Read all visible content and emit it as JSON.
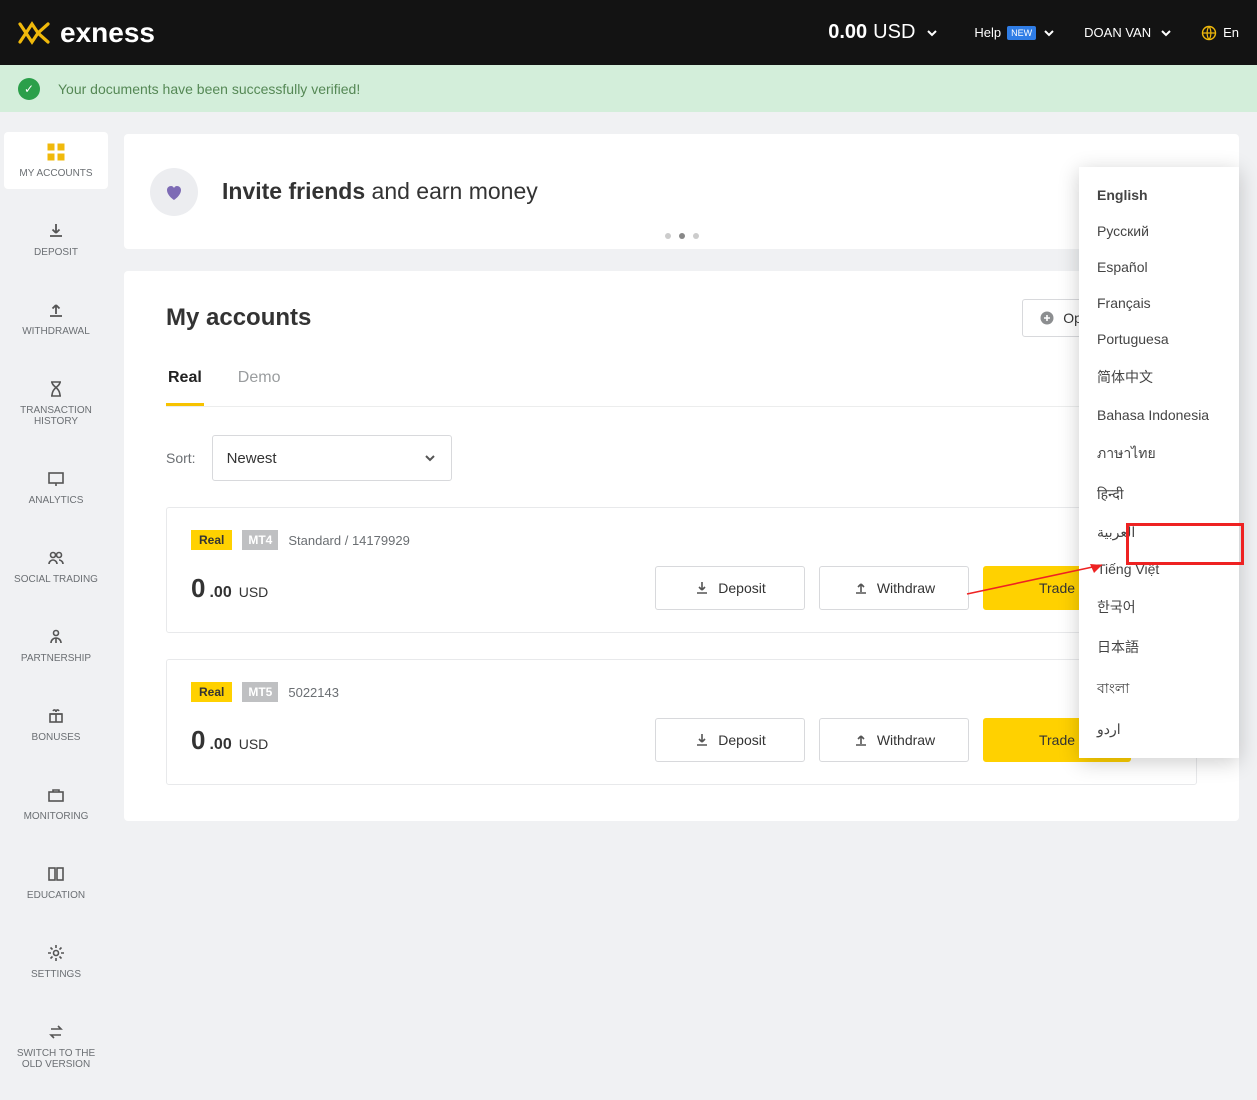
{
  "header": {
    "brand": "exness",
    "balance_amount": "0.00",
    "balance_currency": "USD",
    "help_label": "Help",
    "help_badge": "NEW",
    "username": "DOAN VAN",
    "lang_short": "En"
  },
  "notification": {
    "text": "Your documents have been successfully verified!"
  },
  "sidebar": {
    "items": [
      {
        "label": "MY ACCOUNTS"
      },
      {
        "label": "DEPOSIT"
      },
      {
        "label": "WITHDRAWAL"
      },
      {
        "label": "TRANSACTION HISTORY"
      },
      {
        "label": "ANALYTICS"
      },
      {
        "label": "SOCIAL TRADING"
      },
      {
        "label": "PARTNERSHIP"
      },
      {
        "label": "BONUSES"
      },
      {
        "label": "MONITORING"
      },
      {
        "label": "EDUCATION"
      },
      {
        "label": "SETTINGS"
      },
      {
        "label": "SWITCH TO THE OLD VERSION"
      }
    ]
  },
  "banner": {
    "bold": "Invite friends",
    "rest": " and earn money"
  },
  "main": {
    "title": "My accounts",
    "open_button": "Open new account",
    "tabs": {
      "real": "Real",
      "demo": "Demo"
    },
    "sort_label": "Sort:",
    "sort_value": "Newest"
  },
  "labels": {
    "deposit": "Deposit",
    "withdraw": "Withdraw",
    "trade": "Trade"
  },
  "accounts": [
    {
      "badge": "Real",
      "platform": "MT4",
      "name": "Standard / 14179929",
      "bal_int": "0",
      "bal_dec": ".00",
      "ccy": "USD"
    },
    {
      "badge": "Real",
      "platform": "MT5",
      "name": "5022143",
      "bal_int": "0",
      "bal_dec": ".00",
      "ccy": "USD"
    }
  ],
  "languages": {
    "items": [
      "English",
      "Русский",
      "Español",
      "Français",
      "Portuguesa",
      "简体中文",
      "Bahasa Indonesia",
      "ภาษาไทย",
      "हिन्दी",
      "العربية",
      "Tiếng Việt",
      "한국어",
      "日本語",
      "বাংলা",
      "اردو"
    ],
    "highlighted": "Tiếng Việt"
  }
}
